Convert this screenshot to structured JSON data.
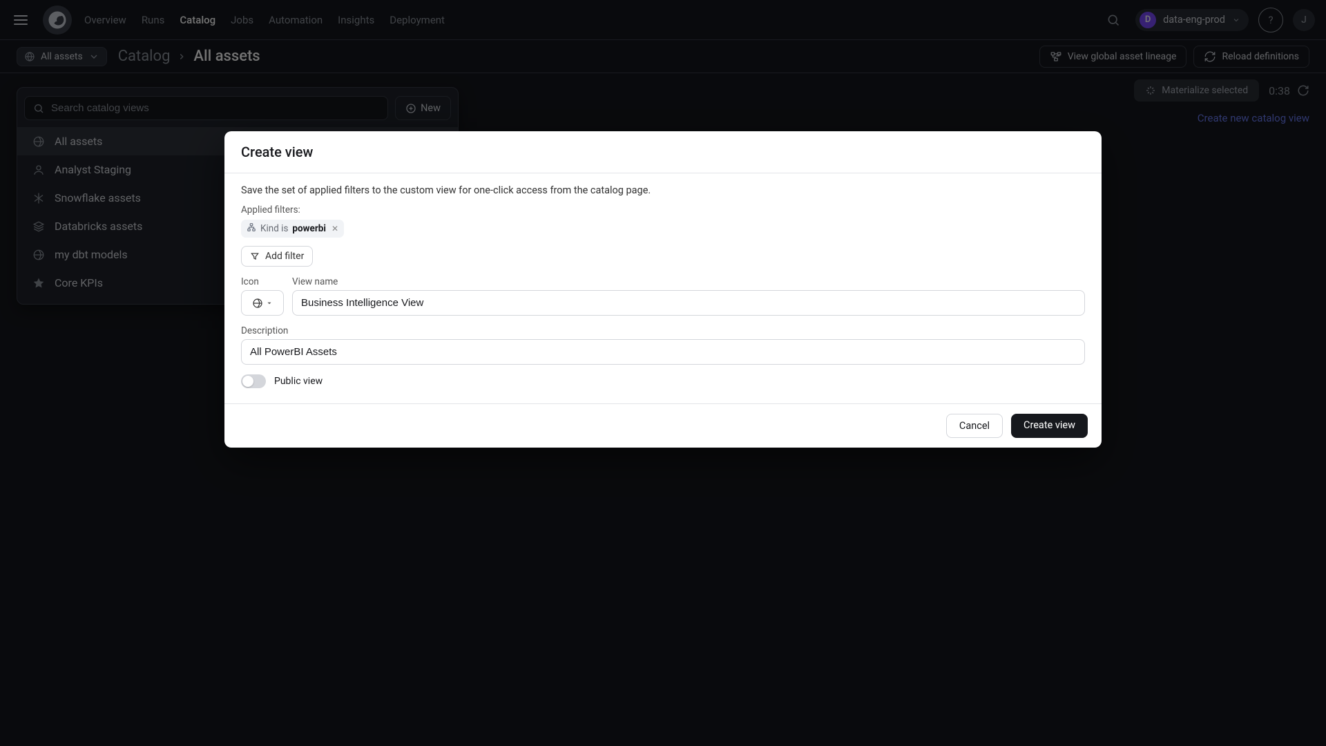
{
  "nav": {
    "items": [
      "Overview",
      "Runs",
      "Catalog",
      "Jobs",
      "Automation",
      "Insights",
      "Deployment"
    ],
    "active": "Catalog"
  },
  "header_right": {
    "deployment_badge_letter": "D",
    "deployment_name": "data-eng-prod",
    "avatar_letter": "J"
  },
  "breadcrumb": {
    "pill_label": "All assets",
    "root": "Catalog",
    "leaf": "All assets"
  },
  "subheader_actions": {
    "lineage": "View global asset lineage",
    "reload": "Reload definitions"
  },
  "views_panel": {
    "search_placeholder": "Search catalog views",
    "new_label": "New",
    "items": [
      {
        "icon": "globe",
        "label": "All assets",
        "active": true
      },
      {
        "icon": "user",
        "label": "Analyst Staging"
      },
      {
        "icon": "snow",
        "label": "Snowflake assets"
      },
      {
        "icon": "cube",
        "label": "Databricks assets"
      },
      {
        "icon": "globe",
        "label": "my dbt models"
      },
      {
        "icon": "star",
        "label": "Core KPIs"
      }
    ]
  },
  "toolbar": {
    "materialize": "Materialize selected",
    "timer": "0:38",
    "create_view_link": "Create new catalog view"
  },
  "modal": {
    "title": "Create view",
    "instructions": "Save the set of applied filters to the custom view for one-click access from the catalog page.",
    "applied_filters_label": "Applied filters:",
    "filter_chip_prefix": "Kind is",
    "filter_chip_value": "powerbi",
    "add_filter_label": "Add filter",
    "icon_label": "Icon",
    "name_label": "View name",
    "name_value": "Business Intelligence View",
    "desc_label": "Description",
    "desc_value": "All PowerBI Assets",
    "public_toggle_label": "Public view",
    "cancel": "Cancel",
    "submit": "Create view"
  }
}
